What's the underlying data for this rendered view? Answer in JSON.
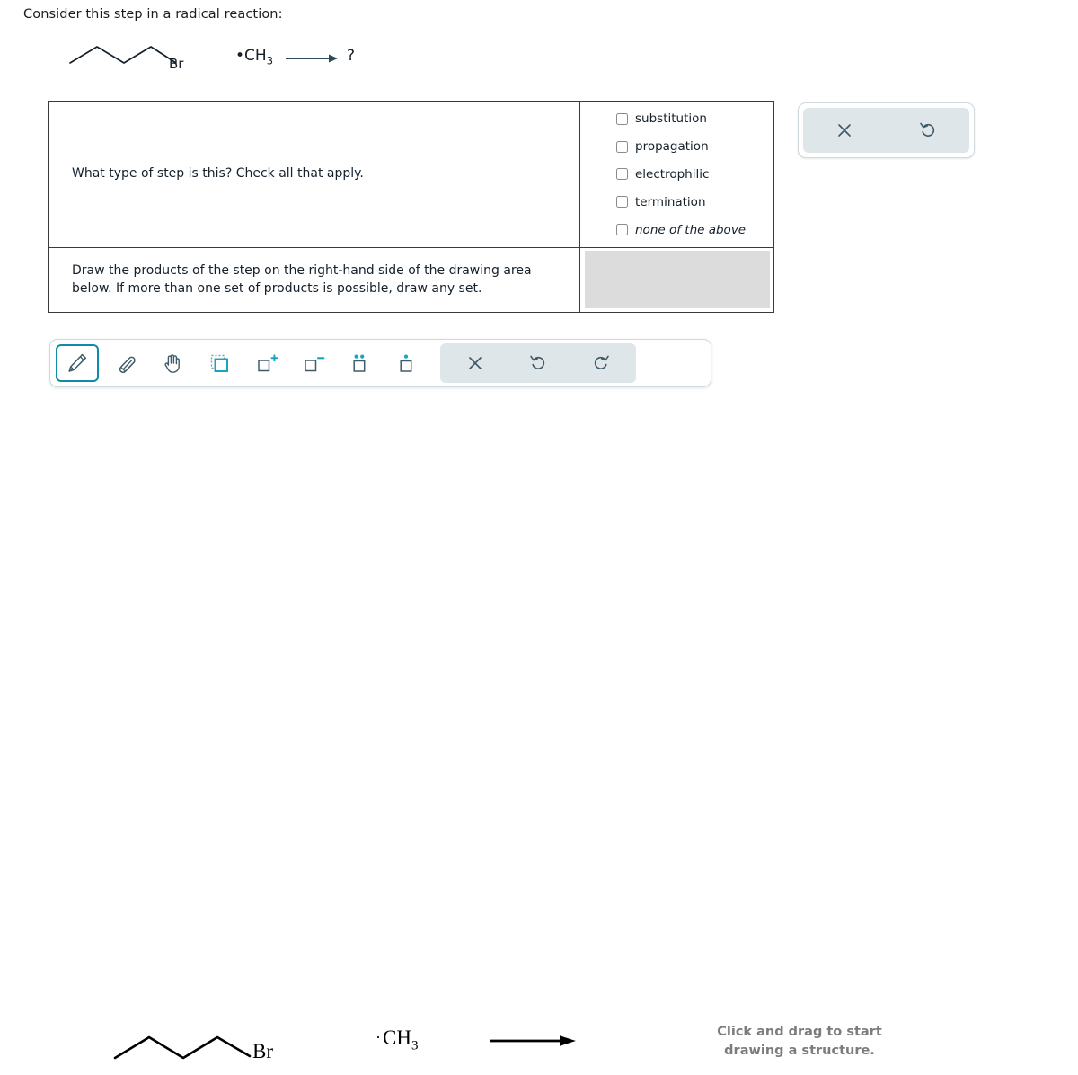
{
  "prompt": "Consider this step in a radical reaction:",
  "reaction_top": {
    "reactant_label": "Br",
    "radical_species": "CH",
    "radical_species_sub": "3",
    "radical_dot": "•",
    "arrow": "reaction-arrow",
    "product_unknown": "?"
  },
  "question_table": {
    "row1": {
      "question": "What type of step is this? Check all that apply.",
      "options": [
        {
          "label": "substitution",
          "checked": false,
          "italic": false
        },
        {
          "label": "propagation",
          "checked": false,
          "italic": false
        },
        {
          "label": "electrophilic",
          "checked": false,
          "italic": false
        },
        {
          "label": "termination",
          "checked": false,
          "italic": false
        },
        {
          "label": "none of the above",
          "checked": false,
          "italic": true
        }
      ]
    },
    "row2": {
      "instruction": "Draw the products of the step on the right-hand side of the drawing area below. If more than one set of products is possible, draw any set.",
      "answer_placeholder": ""
    }
  },
  "mini_panel": {
    "buttons": [
      {
        "name": "clear-button",
        "icon": "x-icon"
      },
      {
        "name": "undo-button",
        "icon": "undo-icon"
      }
    ]
  },
  "toolbar": {
    "tools": [
      {
        "name": "pencil-tool",
        "icon": "pencil-icon",
        "selected": true
      },
      {
        "name": "eraser-tool",
        "icon": "eraser-icon",
        "selected": false
      },
      {
        "name": "pan-tool",
        "icon": "hand-icon",
        "selected": false
      },
      {
        "name": "template-tool",
        "icon": "template-icon",
        "selected": false
      },
      {
        "name": "positive-charge-tool",
        "icon": "plus-charge-icon",
        "selected": false
      },
      {
        "name": "negative-charge-tool",
        "icon": "minus-charge-icon",
        "selected": false
      },
      {
        "name": "lone-pair-tool",
        "icon": "lone-pair-icon",
        "selected": false
      },
      {
        "name": "radical-tool",
        "icon": "radical-icon",
        "selected": false
      }
    ],
    "actions": [
      {
        "name": "clear-canvas-button",
        "icon": "x-icon"
      },
      {
        "name": "undo-button",
        "icon": "undo-icon"
      },
      {
        "name": "redo-button",
        "icon": "redo-icon"
      }
    ]
  },
  "canvas": {
    "molecule_label": "Br",
    "radical_dot": "·",
    "methyl_radical": "CH",
    "methyl_radical_sub": "3",
    "hint_line1": "Click and drag to start",
    "hint_line2": "drawing a structure."
  },
  "colors": {
    "accent_teal": "#0d8ba8",
    "icon_slate": "#3f5b68",
    "table_border": "#3a3a3a",
    "answer_cell": "#dcdcdc",
    "toolbar_group": "#dfe6e9",
    "hint_gray": "#7c7c7c",
    "arrow_top": "#2c4a57"
  }
}
